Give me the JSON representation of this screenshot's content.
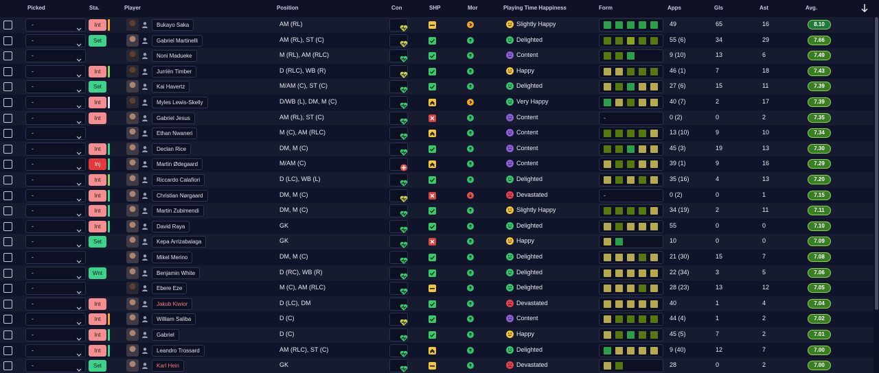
{
  "columns": {
    "picked": "Picked",
    "sta": "Sta.",
    "player": "Player",
    "position": "Position",
    "con": "Con",
    "shp": "SHP",
    "mor": "Mor",
    "pth": "Playing Time Happiness",
    "form": "Form",
    "apps": "Apps",
    "gls": "Gls",
    "ast": "Ast",
    "avg": "Avg."
  },
  "colors": {
    "form_dark": "#56780f",
    "form_mid": "#8ea31d",
    "form_good": "#2c9f4a",
    "form_tan": "#b5a94f",
    "shp_yellow": "#f0c63d",
    "shp_green": "#38c969",
    "shp_red": "#d8453f",
    "mor_orange": "#f0a827",
    "mor_green": "#35c16a",
    "mor_red": "#e0524a",
    "happy_yellow": "#f1c33a",
    "happy_green": "#33c46c",
    "happy_purple": "#8d5fd8",
    "happy_red": "#e6424e"
  },
  "players": [
    {
      "picked": "-",
      "status": "Int",
      "sbar": "#f5a623",
      "dark": true,
      "name": "Bukayo Saka",
      "name_red": false,
      "position": "AM (RL)",
      "con": "heart-yellow",
      "shp": "dash",
      "mor": "orange",
      "pth_icon": "yellow",
      "pth": "Slightly Happy",
      "form": [
        "good",
        "good",
        "good",
        "good",
        "good"
      ],
      "apps": "49",
      "gls": "65",
      "ast": "16",
      "avg": "8.10",
      "avg_bg": "#1d7a3a"
    },
    {
      "picked": "-",
      "status": "Set",
      "sbar": null,
      "dark": false,
      "name": "Gabriel Martinelli",
      "name_red": false,
      "position": "AM (RL), ST (C)",
      "con": "heart-yellow",
      "shp": "check",
      "mor": "green",
      "pth_icon": "green",
      "pth": "Delighted",
      "form": [
        "dark",
        "dark",
        "mid",
        "dark",
        "dark"
      ],
      "apps": "55 (6)",
      "gls": "34",
      "ast": "29",
      "avg": "7.66",
      "avg_bg": "#3a7e24"
    },
    {
      "picked": "-",
      "status": "none",
      "sbar": null,
      "dark": true,
      "name": "Noni Madueke",
      "name_red": false,
      "position": "M (RL), AM (RLC)",
      "con": "heart-green",
      "shp": "check",
      "mor": "green",
      "pth_icon": "purple",
      "pth": "Content",
      "form": [
        "dark",
        "dark",
        "good"
      ],
      "apps": "9 (10)",
      "gls": "13",
      "ast": "6",
      "avg": "7.49",
      "avg_bg": "#3a7e24"
    },
    {
      "picked": "-",
      "status": "Int",
      "sbar": "#8fd15a",
      "dark": true,
      "name": "Jurriën Timber",
      "name_red": false,
      "position": "D (RLC), WB (R)",
      "con": "heart-yellow",
      "shp": "check",
      "mor": "green",
      "pth_icon": "yellow",
      "pth": "Happy",
      "form": [
        "tan",
        "tan",
        "dark",
        "dark",
        "dark"
      ],
      "apps": "46 (1)",
      "gls": "7",
      "ast": "18",
      "avg": "7.43",
      "avg_bg": "#3a7e24"
    },
    {
      "picked": "-",
      "status": "Set",
      "sbar": null,
      "dark": false,
      "name": "Kai Havertz",
      "name_red": false,
      "position": "M/AM (C), ST (C)",
      "con": "heart-green",
      "shp": "check",
      "mor": "green",
      "pth_icon": "green",
      "pth": "Delighted",
      "form": [
        "tan",
        "dark",
        "good",
        "tan",
        "tan"
      ],
      "apps": "27 (6)",
      "gls": "15",
      "ast": "11",
      "avg": "7.39",
      "avg_bg": "#3a7e24"
    },
    {
      "picked": "-",
      "status": "Int",
      "sbar": "#dfe3ee",
      "dark": true,
      "name": "Myles Lewis-Skelly",
      "name_red": false,
      "position": "D/WB (L), DM, M (C)",
      "con": "heart-green",
      "shp": "chevron",
      "mor": "orange",
      "pth_icon": "green",
      "pth": "Very Happy",
      "form": [
        "good",
        "tan",
        "dark",
        "tan",
        "tan"
      ],
      "apps": "40 (7)",
      "gls": "2",
      "ast": "17",
      "avg": "7.39",
      "avg_bg": "#3a7e24"
    },
    {
      "picked": "-",
      "status": "Int",
      "sbar": null,
      "dark": false,
      "name": "Gabriel Jesus",
      "name_red": false,
      "position": "AM (RL), ST (C)",
      "con": "heart-green",
      "shp": "cross",
      "mor": "green",
      "pth_icon": "purple",
      "pth": "Content",
      "form": [],
      "apps": "0 (2)",
      "gls": "0",
      "ast": "2",
      "avg": "7.35",
      "avg_bg": "#3a7e24"
    },
    {
      "picked": "-",
      "status": "none",
      "sbar": null,
      "dark": false,
      "name": "Ethan Nwaneri",
      "name_red": false,
      "position": "M (C), AM (RLC)",
      "con": "heart-green",
      "shp": "chevron",
      "mor": "green",
      "pth_icon": "purple",
      "pth": "Content",
      "form": [
        "dark",
        "dark",
        "dark",
        "dark",
        "tan"
      ],
      "apps": "13 (10)",
      "gls": "9",
      "ast": "10",
      "avg": "7.34",
      "avg_bg": "#3a7e24"
    },
    {
      "picked": "-",
      "status": "Int",
      "sbar": "#3ed38a",
      "dark": false,
      "name": "Declan Rice",
      "name_red": false,
      "position": "DM, M (C)",
      "con": "heart-green",
      "shp": "check",
      "mor": "green",
      "pth_icon": "purple",
      "pth": "Content",
      "form": [
        "dark",
        "dark",
        "good",
        "tan",
        "tan"
      ],
      "apps": "45 (3)",
      "gls": "19",
      "ast": "13",
      "avg": "7.30",
      "avg_bg": "#3a7e24"
    },
    {
      "picked": "-",
      "status": "Inj",
      "sbar": "#3ed38a",
      "dark": false,
      "name": "Martin Ødegaard",
      "name_red": false,
      "position": "M/AM (C)",
      "con": "plus-red",
      "shp": "chevron",
      "mor": "green",
      "pth_icon": "purple",
      "pth": "Content",
      "form": [
        "tan",
        "dark",
        "dark",
        "tan",
        "tan"
      ],
      "apps": "39 (1)",
      "gls": "9",
      "ast": "16",
      "avg": "7.29",
      "avg_bg": "#3a7e24"
    },
    {
      "picked": "-",
      "status": "Int",
      "sbar": "#8fd15a",
      "dark": false,
      "name": "Riccardo Calafiori",
      "name_red": false,
      "position": "D (LC), WB (L)",
      "con": "heart-green",
      "shp": "check",
      "mor": "green",
      "pth_icon": "green",
      "pth": "Delighted",
      "form": [
        "tan",
        "dark",
        "tan",
        "dark",
        "tan"
      ],
      "apps": "35 (16)",
      "gls": "4",
      "ast": "13",
      "avg": "7.20",
      "avg_bg": "#3a7e24"
    },
    {
      "picked": "-",
      "status": "Int",
      "sbar": "#3ed38a",
      "dark": false,
      "name": "Christian Nørgaard",
      "name_red": false,
      "position": "DM, M (C)",
      "con": "heart-yellow",
      "shp": "cross",
      "mor": "red",
      "pth_icon": "red",
      "pth": "Devastated",
      "form": [],
      "apps": "0 (2)",
      "gls": "0",
      "ast": "1",
      "avg": "7.15",
      "avg_bg": "#3a7e24"
    },
    {
      "picked": "-",
      "status": "Int",
      "sbar": "#3ed38a",
      "dark": false,
      "name": "Martin Zubimendi",
      "name_red": false,
      "position": "DM, M (C)",
      "con": "heart-green",
      "shp": "check",
      "mor": "green",
      "pth_icon": "yellow",
      "pth": "Slightly Happy",
      "form": [
        "dark",
        "dark",
        "dark",
        "dark",
        "tan"
      ],
      "apps": "34 (19)",
      "gls": "2",
      "ast": "11",
      "avg": "7.11",
      "avg_bg": "#3a7e24"
    },
    {
      "picked": "-",
      "status": "Int",
      "sbar": "#3ed38a",
      "dark": false,
      "name": "David Raya",
      "name_red": false,
      "position": "GK",
      "con": "heart-green",
      "shp": "check",
      "mor": "green",
      "pth_icon": "green",
      "pth": "Delighted",
      "form": [
        "tan",
        "dark",
        "tan",
        "tan",
        "tan"
      ],
      "apps": "55",
      "gls": "0",
      "ast": "0",
      "avg": "7.10",
      "avg_bg": "#3a7e24"
    },
    {
      "picked": "-",
      "status": "Set",
      "sbar": null,
      "dark": false,
      "name": "Kepa Arrizabalaga",
      "name_red": false,
      "position": "GK",
      "con": "heart-green",
      "shp": "cross",
      "mor": "green",
      "pth_icon": "yellow",
      "pth": "Happy",
      "form": [
        "tan",
        "good"
      ],
      "apps": "10",
      "gls": "0",
      "ast": "0",
      "avg": "7.09",
      "avg_bg": "#3a7e24"
    },
    {
      "picked": "-",
      "status": "none",
      "sbar": null,
      "dark": false,
      "name": "Mikel Merino",
      "name_red": false,
      "position": "DM, M (C)",
      "con": "heart-green",
      "shp": "check",
      "mor": "green",
      "pth_icon": "green",
      "pth": "Delighted",
      "form": [
        "tan",
        "tan",
        "tan",
        "dark",
        "tan"
      ],
      "apps": "21 (30)",
      "gls": "15",
      "ast": "7",
      "avg": "7.08",
      "avg_bg": "#3a7e24"
    },
    {
      "picked": "-",
      "status": "Wnt",
      "sbar": null,
      "dark": false,
      "name": "Benjamin White",
      "name_red": false,
      "position": "D (RC), WB (R)",
      "con": "heart-green",
      "shp": "check",
      "mor": "green",
      "pth_icon": "green",
      "pth": "Delighted",
      "form": [
        "tan",
        "tan",
        "tan",
        "tan",
        "tan"
      ],
      "apps": "22 (34)",
      "gls": "3",
      "ast": "5",
      "avg": "7.06",
      "avg_bg": "#3a7e24"
    },
    {
      "picked": "-",
      "status": "none",
      "sbar": null,
      "dark": true,
      "name": "Ebere Eze",
      "name_red": false,
      "position": "M (C), AM (RLC)",
      "con": "heart-green",
      "shp": "dash",
      "mor": "green",
      "pth_icon": "green",
      "pth": "Delighted",
      "form": [
        "tan",
        "tan",
        "tan",
        "dark",
        "tan"
      ],
      "apps": "28 (23)",
      "gls": "13",
      "ast": "12",
      "avg": "7.05",
      "avg_bg": "#3a7e24"
    },
    {
      "picked": "-",
      "status": "Int",
      "sbar": null,
      "dark": false,
      "name": "Jakub Kiwior",
      "name_red": true,
      "position": "D (LC), DM",
      "con": "heart-green",
      "shp": "check",
      "mor": "green",
      "pth_icon": "red",
      "pth": "Devastated",
      "form": [
        "tan",
        "tan",
        "tan",
        "tan",
        "tan"
      ],
      "apps": "40",
      "gls": "1",
      "ast": "4",
      "avg": "7.04",
      "avg_bg": "#3a7e24"
    },
    {
      "picked": "-",
      "status": "Int",
      "sbar": "#f5a623",
      "dark": false,
      "name": "William Saliba",
      "name_red": false,
      "position": "D (C)",
      "con": "heart-yellow",
      "shp": "check",
      "mor": "green",
      "pth_icon": "purple",
      "pth": "Content",
      "form": [
        "tan",
        "dark",
        "dark",
        "dark",
        "dark"
      ],
      "apps": "44 (4)",
      "gls": "1",
      "ast": "2",
      "avg": "7.02",
      "avg_bg": "#3a7e24"
    },
    {
      "picked": "-",
      "status": "Int",
      "sbar": "#3ed38a",
      "dark": false,
      "name": "Gabriel",
      "name_red": false,
      "position": "D (C)",
      "con": "heart-green",
      "shp": "check",
      "mor": "green",
      "pth_icon": "yellow",
      "pth": "Happy",
      "form": [
        "tan",
        "dark",
        "good",
        "dark",
        "dark"
      ],
      "apps": "45 (5)",
      "gls": "7",
      "ast": "2",
      "avg": "7.01",
      "avg_bg": "#3a7e24"
    },
    {
      "picked": "-",
      "status": "Int",
      "sbar": "#3ed38a",
      "dark": false,
      "name": "Leandro Trossard",
      "name_red": false,
      "position": "AM (RLC), ST (C)",
      "con": "heart-green",
      "shp": "chevron",
      "mor": "green",
      "pth_icon": "green",
      "pth": "Delighted",
      "form": [
        "good",
        "tan",
        "tan",
        "tan",
        "tan"
      ],
      "apps": "9 (40)",
      "gls": "12",
      "ast": "7",
      "avg": "7.00",
      "avg_bg": "#3a7e24"
    },
    {
      "picked": "-",
      "status": "Set",
      "sbar": null,
      "dark": false,
      "name": "Karl Hein",
      "name_red": true,
      "position": "GK",
      "con": "heart-green",
      "shp": "dash",
      "mor": "green",
      "pth_icon": "red",
      "pth": "Devastated",
      "form": [
        "tan",
        "dark"
      ],
      "apps": "28",
      "gls": "0",
      "ast": "2",
      "avg": "7.00",
      "avg_bg": "#3a7e24"
    }
  ]
}
